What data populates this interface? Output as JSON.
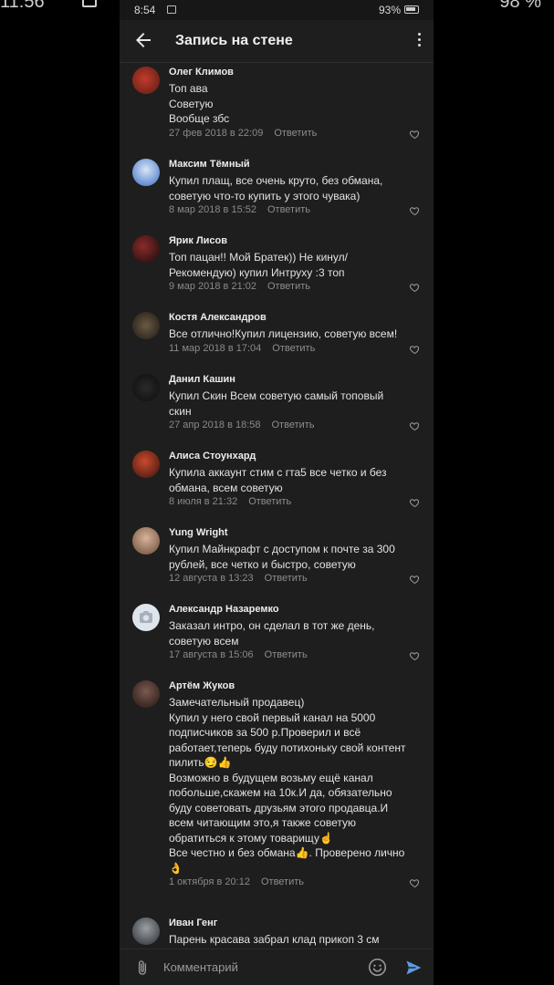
{
  "outer_status": {
    "time": "11:56",
    "right": "98 %"
  },
  "status_bar": {
    "time": "8:54",
    "icons": "✕ ⇅ ıl",
    "battery": "93%"
  },
  "app_bar": {
    "title": "Запись на стене"
  },
  "comments": [
    {
      "name": "Олег Климов",
      "lines": [
        "Топ ава",
        "Советую",
        "Вообще збс"
      ],
      "date": "27 фев 2018 в 22:09",
      "reply": "Ответить"
    },
    {
      "name": "Максим Тёмный",
      "lines": [
        "Купил плащ, все очень круто, без обмана,",
        "советую что-то купить у этого чувака)"
      ],
      "date": "8 мар 2018 в 15:52",
      "reply": "Ответить"
    },
    {
      "name": "Ярик Лисов",
      "lines": [
        "Топ пацан!! Мой Братек)) Не кинул/",
        "Рекомендую) купил Интруху :3 топ"
      ],
      "date": "9 мар 2018 в 21:02",
      "reply": "Ответить"
    },
    {
      "name": "Костя Александров",
      "lines": [
        "Все отлично!Купил лицензию, советую всем!"
      ],
      "date": "11 мар 2018 в 17:04",
      "reply": "Ответить"
    },
    {
      "name": "Данил Кашин",
      "lines": [
        "Купил Скин Всем советую самый топовый",
        "скин"
      ],
      "date": "27 апр 2018 в 18:58",
      "reply": "Ответить"
    },
    {
      "name": "Алиса Стоунхард",
      "lines": [
        "Купила аккаунт стим с гта5 все четко и без",
        "обмана, всем советую"
      ],
      "date": "8 июля в 21:32",
      "reply": "Ответить"
    },
    {
      "name": "Yung Wright",
      "lines": [
        "Купил Майнкрафт с доступом к почте за 300",
        "рублей, все четко и быстро, советую"
      ],
      "date": "12 августа в 13:23",
      "reply": "Ответить"
    },
    {
      "name": "Александр Назаремко",
      "lines": [
        "Заказал интро, он сделал в тот же день,",
        "советую всем"
      ],
      "date": "17 августа в 15:06",
      "reply": "Ответить"
    },
    {
      "name": "Артём Жуков",
      "lines": [
        "Замечательный продавец)",
        "Купил у него свой первый канал на 5000",
        "подписчиков за 500 р.Проверил и всё",
        "работает,теперь буду потихоньку свой контент",
        "пилить😏👍",
        "Возможно в будущем возьму ещё канал",
        "побольше,скажем на 10к.И да, обязательно",
        "буду советовать друзьям этого продавца.И",
        "всем читающим это,я также советую",
        "обратиться к этому товарищу☝️",
        "Все честно и без обмана👍. Проверено лично",
        "👌"
      ],
      "date": "1 октября в 20:12",
      "reply": "Ответить"
    },
    {
      "name": "Иван Генг",
      "lines": [
        "Парень красава забрал клад прикоп 3 см"
      ],
      "date": "",
      "reply": ""
    }
  ],
  "comment_bar": {
    "placeholder": "Комментарий"
  },
  "colors": {
    "background": "#1e1e1e",
    "accent": "#5c9ce6",
    "meta": "#8a8a8a"
  }
}
